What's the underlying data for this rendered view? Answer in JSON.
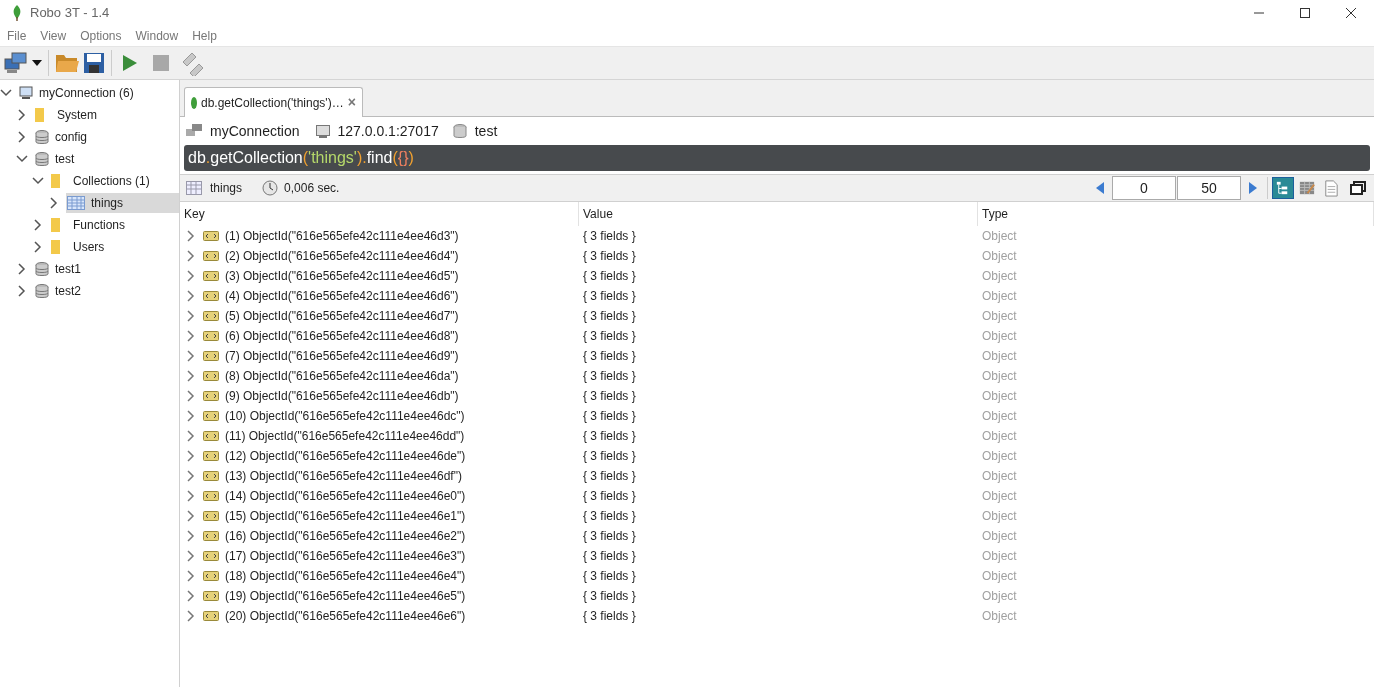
{
  "window": {
    "title": "Robo 3T - 1.4"
  },
  "menu": [
    "File",
    "View",
    "Options",
    "Window",
    "Help"
  ],
  "tree": [
    {
      "label": "myConnection (6)",
      "kind": "server",
      "expanded": true,
      "selected": false,
      "children": [
        {
          "label": "System",
          "kind": "folder",
          "expanded": false,
          "selected": false
        },
        {
          "label": "config",
          "kind": "database",
          "expanded": false,
          "selected": false
        },
        {
          "label": "test",
          "kind": "database",
          "expanded": true,
          "selected": false,
          "children": [
            {
              "label": "Collections (1)",
              "kind": "folder",
              "expanded": true,
              "selected": false,
              "children": [
                {
                  "label": "things",
                  "kind": "collection",
                  "expanded": false,
                  "selected": true
                }
              ]
            },
            {
              "label": "Functions",
              "kind": "folder",
              "expanded": false,
              "selected": false
            },
            {
              "label": "Users",
              "kind": "folder",
              "expanded": false,
              "selected": false
            }
          ]
        },
        {
          "label": "test1",
          "kind": "database",
          "expanded": false,
          "selected": false
        },
        {
          "label": "test2",
          "kind": "database",
          "expanded": false,
          "selected": false
        }
      ]
    }
  ],
  "tab": {
    "title": "db.getCollection('things')…",
    "close": "×"
  },
  "context": {
    "connection": "myConnection",
    "host": "127.0.0.1:27017",
    "database": "test"
  },
  "query": [
    {
      "text": "db",
      "kind": "plain"
    },
    {
      "text": ".",
      "kind": "punct"
    },
    {
      "text": "getCollection",
      "kind": "plain"
    },
    {
      "text": "(",
      "kind": "punct"
    },
    {
      "text": "'things'",
      "kind": "string"
    },
    {
      "text": ")",
      "kind": "punct"
    },
    {
      "text": ".",
      "kind": "punct"
    },
    {
      "text": "find",
      "kind": "plain"
    },
    {
      "text": "(",
      "kind": "punct"
    },
    {
      "text": "{}",
      "kind": "brace"
    },
    {
      "text": ")",
      "kind": "punct"
    }
  ],
  "results_bar": {
    "collection": "things",
    "time": "0,006 sec.",
    "skip": "0",
    "limit": "50",
    "views": [
      {
        "kind": "tree",
        "selected": true
      },
      {
        "kind": "table",
        "selected": false
      },
      {
        "kind": "text",
        "selected": false
      }
    ]
  },
  "table": {
    "columns": [
      "Key",
      "Value",
      "Type"
    ],
    "rows": [
      {
        "key": "(1) ObjectId(\"616e565efe42c111e4ee46d3\")",
        "value": "{ 3 fields }",
        "type": "Object"
      },
      {
        "key": "(2) ObjectId(\"616e565efe42c111e4ee46d4\")",
        "value": "{ 3 fields }",
        "type": "Object"
      },
      {
        "key": "(3) ObjectId(\"616e565efe42c111e4ee46d5\")",
        "value": "{ 3 fields }",
        "type": "Object"
      },
      {
        "key": "(4) ObjectId(\"616e565efe42c111e4ee46d6\")",
        "value": "{ 3 fields }",
        "type": "Object"
      },
      {
        "key": "(5) ObjectId(\"616e565efe42c111e4ee46d7\")",
        "value": "{ 3 fields }",
        "type": "Object"
      },
      {
        "key": "(6) ObjectId(\"616e565efe42c111e4ee46d8\")",
        "value": "{ 3 fields }",
        "type": "Object"
      },
      {
        "key": "(7) ObjectId(\"616e565efe42c111e4ee46d9\")",
        "value": "{ 3 fields }",
        "type": "Object"
      },
      {
        "key": "(8) ObjectId(\"616e565efe42c111e4ee46da\")",
        "value": "{ 3 fields }",
        "type": "Object"
      },
      {
        "key": "(9) ObjectId(\"616e565efe42c111e4ee46db\")",
        "value": "{ 3 fields }",
        "type": "Object"
      },
      {
        "key": "(10) ObjectId(\"616e565efe42c111e4ee46dc\")",
        "value": "{ 3 fields }",
        "type": "Object"
      },
      {
        "key": "(11) ObjectId(\"616e565efe42c111e4ee46dd\")",
        "value": "{ 3 fields }",
        "type": "Object"
      },
      {
        "key": "(12) ObjectId(\"616e565efe42c111e4ee46de\")",
        "value": "{ 3 fields }",
        "type": "Object"
      },
      {
        "key": "(13) ObjectId(\"616e565efe42c111e4ee46df\")",
        "value": "{ 3 fields }",
        "type": "Object"
      },
      {
        "key": "(14) ObjectId(\"616e565efe42c111e4ee46e0\")",
        "value": "{ 3 fields }",
        "type": "Object"
      },
      {
        "key": "(15) ObjectId(\"616e565efe42c111e4ee46e1\")",
        "value": "{ 3 fields }",
        "type": "Object"
      },
      {
        "key": "(16) ObjectId(\"616e565efe42c111e4ee46e2\")",
        "value": "{ 3 fields }",
        "type": "Object"
      },
      {
        "key": "(17) ObjectId(\"616e565efe42c111e4ee46e3\")",
        "value": "{ 3 fields }",
        "type": "Object"
      },
      {
        "key": "(18) ObjectId(\"616e565efe42c111e4ee46e4\")",
        "value": "{ 3 fields }",
        "type": "Object"
      },
      {
        "key": "(19) ObjectId(\"616e565efe42c111e4ee46e5\")",
        "value": "{ 3 fields }",
        "type": "Object"
      },
      {
        "key": "(20) ObjectId(\"616e565efe42c111e4ee46e6\")",
        "value": "{ 3 fields }",
        "type": "Object"
      }
    ]
  }
}
